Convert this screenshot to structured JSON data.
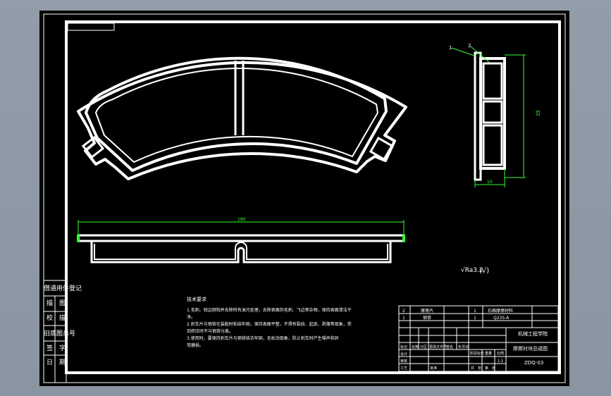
{
  "side_table": {
    "rows": [
      "借通用件登记",
      "描　图",
      "校　描",
      "旧底图总号",
      "签　字",
      "日　期"
    ]
  },
  "notes": {
    "title": "技术要求",
    "lines": [
      "1.毛刺、锐边倒钝并去除所有油污处理，去除表面的毛刺、飞边等杂物，保持表面清洁干",
      "净。",
      "2.刹车片与钢背在装配时粘结牢固，保持表面平整，不得有裂纹、起皮、剥落等现象，受",
      "到挤压时不与钢背分离。",
      "3.使用时，要保持刹车片与钢背结合牢固，无松动现象，防止刹车时产生噪声和异",
      "常磨损。"
    ]
  },
  "dimensions": {
    "length": "180",
    "height": "35",
    "thickness": "10"
  },
  "leaders": [
    "1",
    "2"
  ],
  "roughness": {
    "symbol1": "√Ra3.2",
    "symbol2": "(√)"
  },
  "title_block": {
    "parts": [
      {
        "no": "2",
        "name": "摩擦片",
        "qty": "1",
        "material": "石棉摩擦材料"
      },
      {
        "no": "1",
        "name": "钢背",
        "qty": "1",
        "material": "Q235-A"
      }
    ],
    "header_labels": [
      "标记",
      "处数",
      "分区",
      "更改文件号",
      "签名",
      "年月日"
    ],
    "lower_labels": [
      "设计",
      "审核",
      "工艺",
      "批准"
    ],
    "stage_labels": [
      "阶段标记",
      "重量",
      "比例"
    ],
    "sheet_labels": [
      "共",
      "张",
      "第",
      "张"
    ],
    "scale_value": "1:1",
    "company": "机械工程学院",
    "drawing_title": "摩擦衬块总成图",
    "drawing_number": "ZDQ-03"
  },
  "colors": {
    "background": "#8e98a4",
    "paper": "#000000",
    "line": "#ffffff",
    "dimension": "#33ff33"
  }
}
